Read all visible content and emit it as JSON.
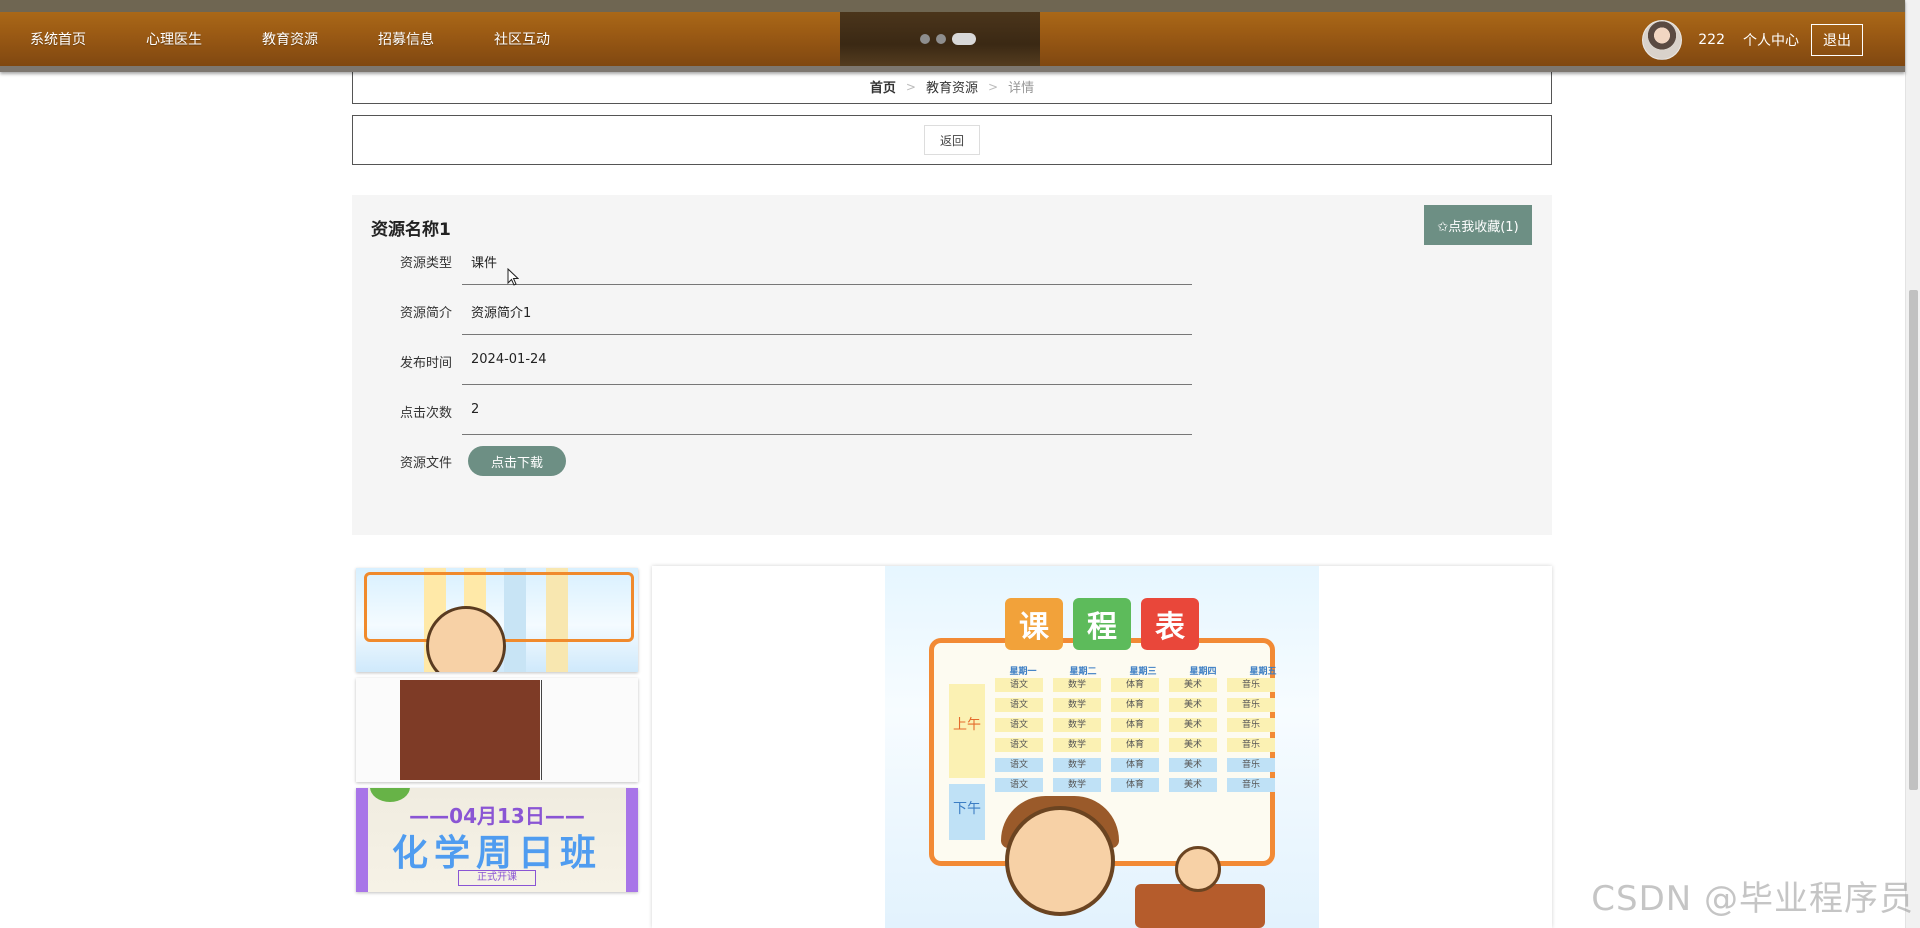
{
  "nav": {
    "items": [
      "系统首页",
      "心理医生",
      "教育资源",
      "招募信息",
      "社区互动"
    ],
    "username": "222",
    "center": "个人中心",
    "logout": "退出"
  },
  "breadcrumb": {
    "home": "首页",
    "section": "教育资源",
    "current": "详情",
    "separator": ">"
  },
  "back_label": "返回",
  "resource": {
    "title": "资源名称1",
    "favorite_label": "✩点我收藏(1)",
    "fields": [
      {
        "label": "资源类型",
        "value": "课件"
      },
      {
        "label": "资源简介",
        "value": "资源简介1"
      },
      {
        "label": "发布时间",
        "value": "2024-01-24"
      },
      {
        "label": "点击次数",
        "value": "2"
      }
    ],
    "file_label": "资源文件",
    "download_label": "点击下载"
  },
  "gallery": {
    "thumb3_date": "——04月13日——",
    "thumb3_title": "化学周日班",
    "thumb3_tag": "正式开课",
    "poster_title": [
      "课",
      "程",
      "表"
    ],
    "poster_days": [
      "星期一",
      "星期二",
      "星期三",
      "星期四",
      "星期五"
    ],
    "poster_am": "上午",
    "poster_pm": "下午",
    "poster_rows": [
      [
        "语文",
        "数学",
        "体育",
        "美术",
        "音乐"
      ],
      [
        "语文",
        "数学",
        "体育",
        "美术",
        "音乐"
      ],
      [
        "语文",
        "数学",
        "体育",
        "美术",
        "音乐"
      ],
      [
        "语文",
        "数学",
        "体育",
        "美术",
        "音乐"
      ],
      [
        "语文",
        "数学",
        "体育",
        "美术",
        "音乐"
      ],
      [
        "语文",
        "数学",
        "体育",
        "美术",
        "音乐"
      ]
    ]
  },
  "watermark": "CSDN @毕业程序员",
  "colors": {
    "accent": "#6d8f84",
    "nav_brown": "#9c5b14"
  }
}
